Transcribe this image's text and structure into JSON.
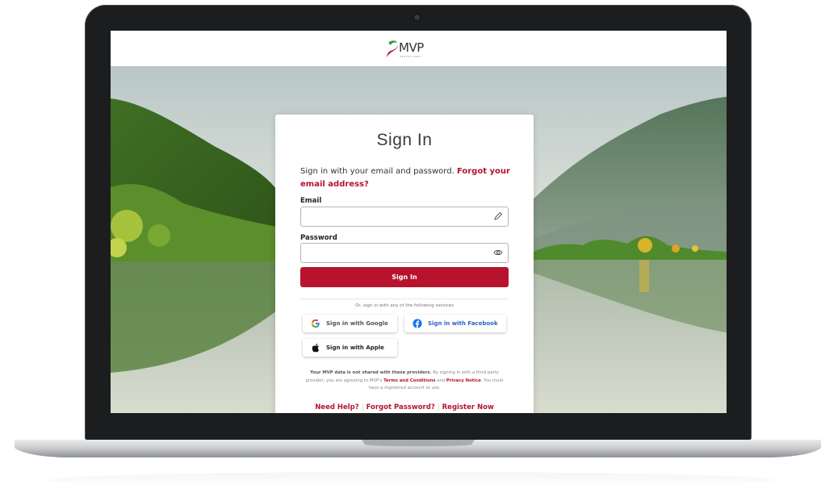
{
  "brand": {
    "name": "MVP",
    "tagline": "HEALTH CARE",
    "accent_color": "#b3152f",
    "logo_green": "#2e9c3a"
  },
  "signin_form": {
    "title": "Sign In",
    "intro_text": "Sign in with your email and password.",
    "intro_link": "Forgot your email address?",
    "email_label": "Email",
    "email_value": "",
    "email_icon": "pencil-icon",
    "password_label": "Password",
    "password_value": "",
    "password_icon": "eye-icon",
    "submit_label": "Sign In",
    "divider_text": "Or, sign in with any of the following services"
  },
  "social_buttons": {
    "google": "Sign in with Google",
    "facebook": "Sign in with Facebook",
    "apple": "Sign in with Apple"
  },
  "disclaimer": {
    "bold_lead": "Your MVP data is not shared with these providers.",
    "text_1": "By signing in with a third party provider, you are agreeing to MVP's",
    "terms_link": "Terms and Conditions",
    "and": "and",
    "privacy_link": "Privacy Notice",
    "text_2": ". You must have a registered account to use."
  },
  "footer_links": {
    "help": "Need Help?",
    "forgot_password": "Forgot Password?",
    "register": "Register Now"
  }
}
